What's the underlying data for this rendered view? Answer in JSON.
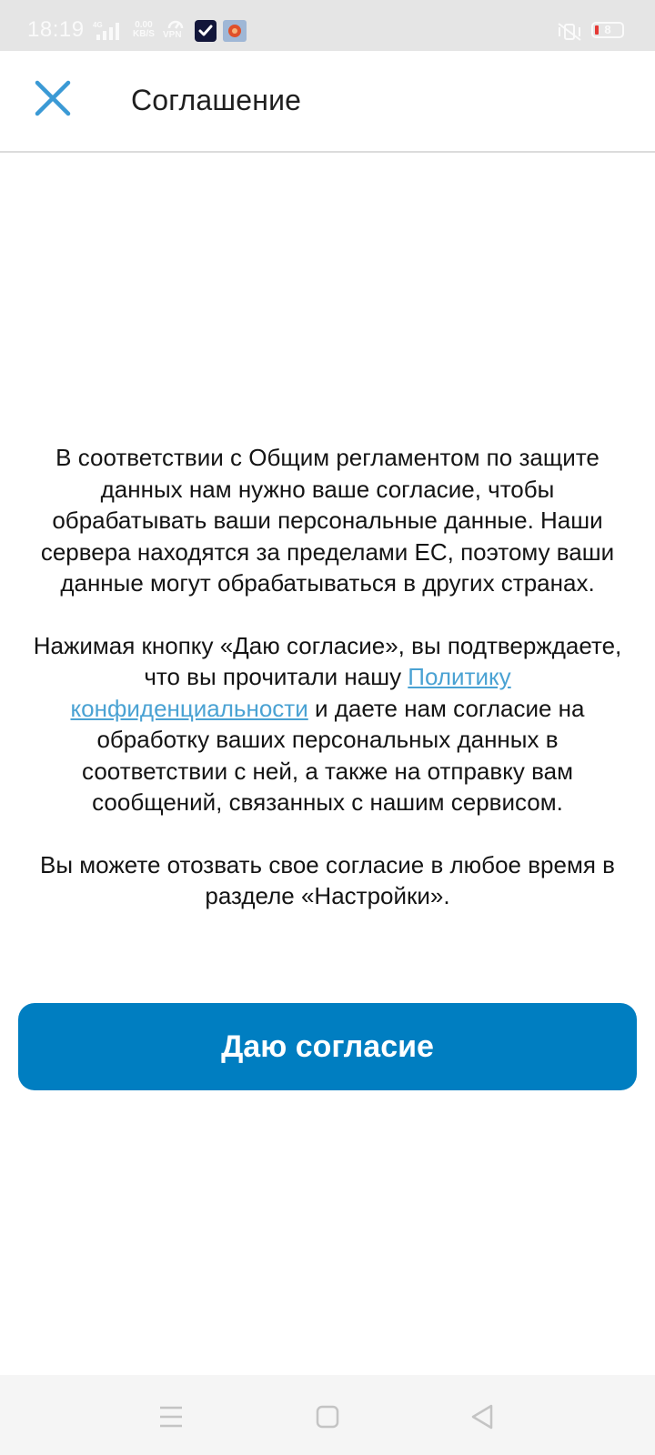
{
  "status_bar": {
    "time": "18:19",
    "network_speed_value": "0.00",
    "network_speed_unit": "KB/S",
    "vpn_label": "VPN",
    "battery_level": "8"
  },
  "header": {
    "title": "Соглашение"
  },
  "content": {
    "paragraph1": "В соответствии с Общим регламентом по защите данных нам нужно ваше согласие, чтобы обрабатывать ваши персональные данные. Наши сервера находятся за пределами ЕС, поэтому ваши данные могут обрабатываться в других странах.",
    "paragraph2_before_link": "Нажимая кнопку «Даю согласие», вы подтверждаете, что вы прочитали нашу ",
    "policy_link": "Политику конфиденциальности",
    "paragraph2_after_link": " и даете нам согласие на обработку ваших персональных данных в соответствии с ней, а также на отправку вам сообщений, связанных с нашим сервисом.",
    "paragraph3": "Вы можете отозвать свое согласие в любое время в разделе «Настройки»."
  },
  "consent_button": {
    "label": "Даю согласие"
  },
  "colors": {
    "accent": "#007ec1",
    "link": "#4aa2d3",
    "close_icon": "#3b9ad5"
  },
  "icons": {
    "close": "close-icon",
    "nav_menu": "menu-icon",
    "nav_home": "home-icon",
    "nav_back": "back-icon"
  }
}
